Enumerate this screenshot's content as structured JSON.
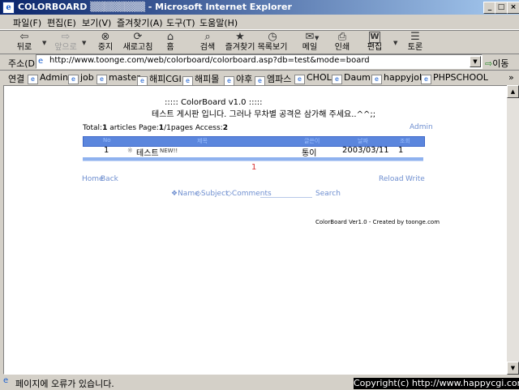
{
  "window": {
    "title": "COLORBOARD ▒▒▒▒▒▒▒▒ - Microsoft Internet Explorer",
    "minimize": "_",
    "maximize": "□",
    "close": "×"
  },
  "menu": [
    "파일(F)",
    "편집(E)",
    "보기(V)",
    "즐겨찾기(A)",
    "도구(T)",
    "도움말(H)"
  ],
  "toolbar": {
    "back": "뒤로",
    "forward": "앞으로",
    "stop": "중지",
    "refresh": "새로고침",
    "home": "홈",
    "search": "검색",
    "favorites": "즐겨찾기",
    "history": "목록보기",
    "mail": "메일",
    "print": "인쇄",
    "edit": "편집",
    "discuss": "토론"
  },
  "address": {
    "label": "주소(D)",
    "url": "http://www.toonge.com/web/colorboard/colorboard.asp?db=test&mode=board",
    "go": "이동"
  },
  "links": {
    "label": "연결",
    "items": [
      "Admin",
      "job",
      "master",
      "해피CGI",
      "해피몰",
      "야후",
      "엠파스",
      "CHOL",
      "Daum",
      "happyjob",
      "PHPSCHOOL"
    ],
    "more": "»"
  },
  "board": {
    "title": "::::: ColorBoard v1.0 :::::",
    "subtitle": "테스트 게시판 입니다. 그러나 무차별 공격은 삼가해 주세요..^^;;",
    "total_label": "Total:",
    "total": "1",
    "articles_label": " articles Page:",
    "page": "1",
    "pages_label": "/1pages Access:",
    "access": "2",
    "admin": "Admin",
    "headers": [
      "No",
      "제목",
      "글쓴이",
      "날짜",
      "조회"
    ],
    "rows": [
      {
        "no": "1",
        "bullet": "※",
        "subject": "테스트",
        "new": "NEW!!",
        "author": "통이",
        "date": "2003/03/11",
        "hits": "1"
      }
    ],
    "page_number": "1",
    "home": "Home",
    "back": "Back",
    "reload": "Reload",
    "write": "Write",
    "search": {
      "name": "❖Name",
      "subject": "◇Subject",
      "comments": "◇Comments",
      "button": "Search"
    },
    "footer": "ColorBoard Ver1.0 - Created by toonge.com"
  },
  "status": {
    "text": "페이지에 오류가 있습니다.",
    "copyright": "Copyright(c) http://www.happycgi.com"
  }
}
